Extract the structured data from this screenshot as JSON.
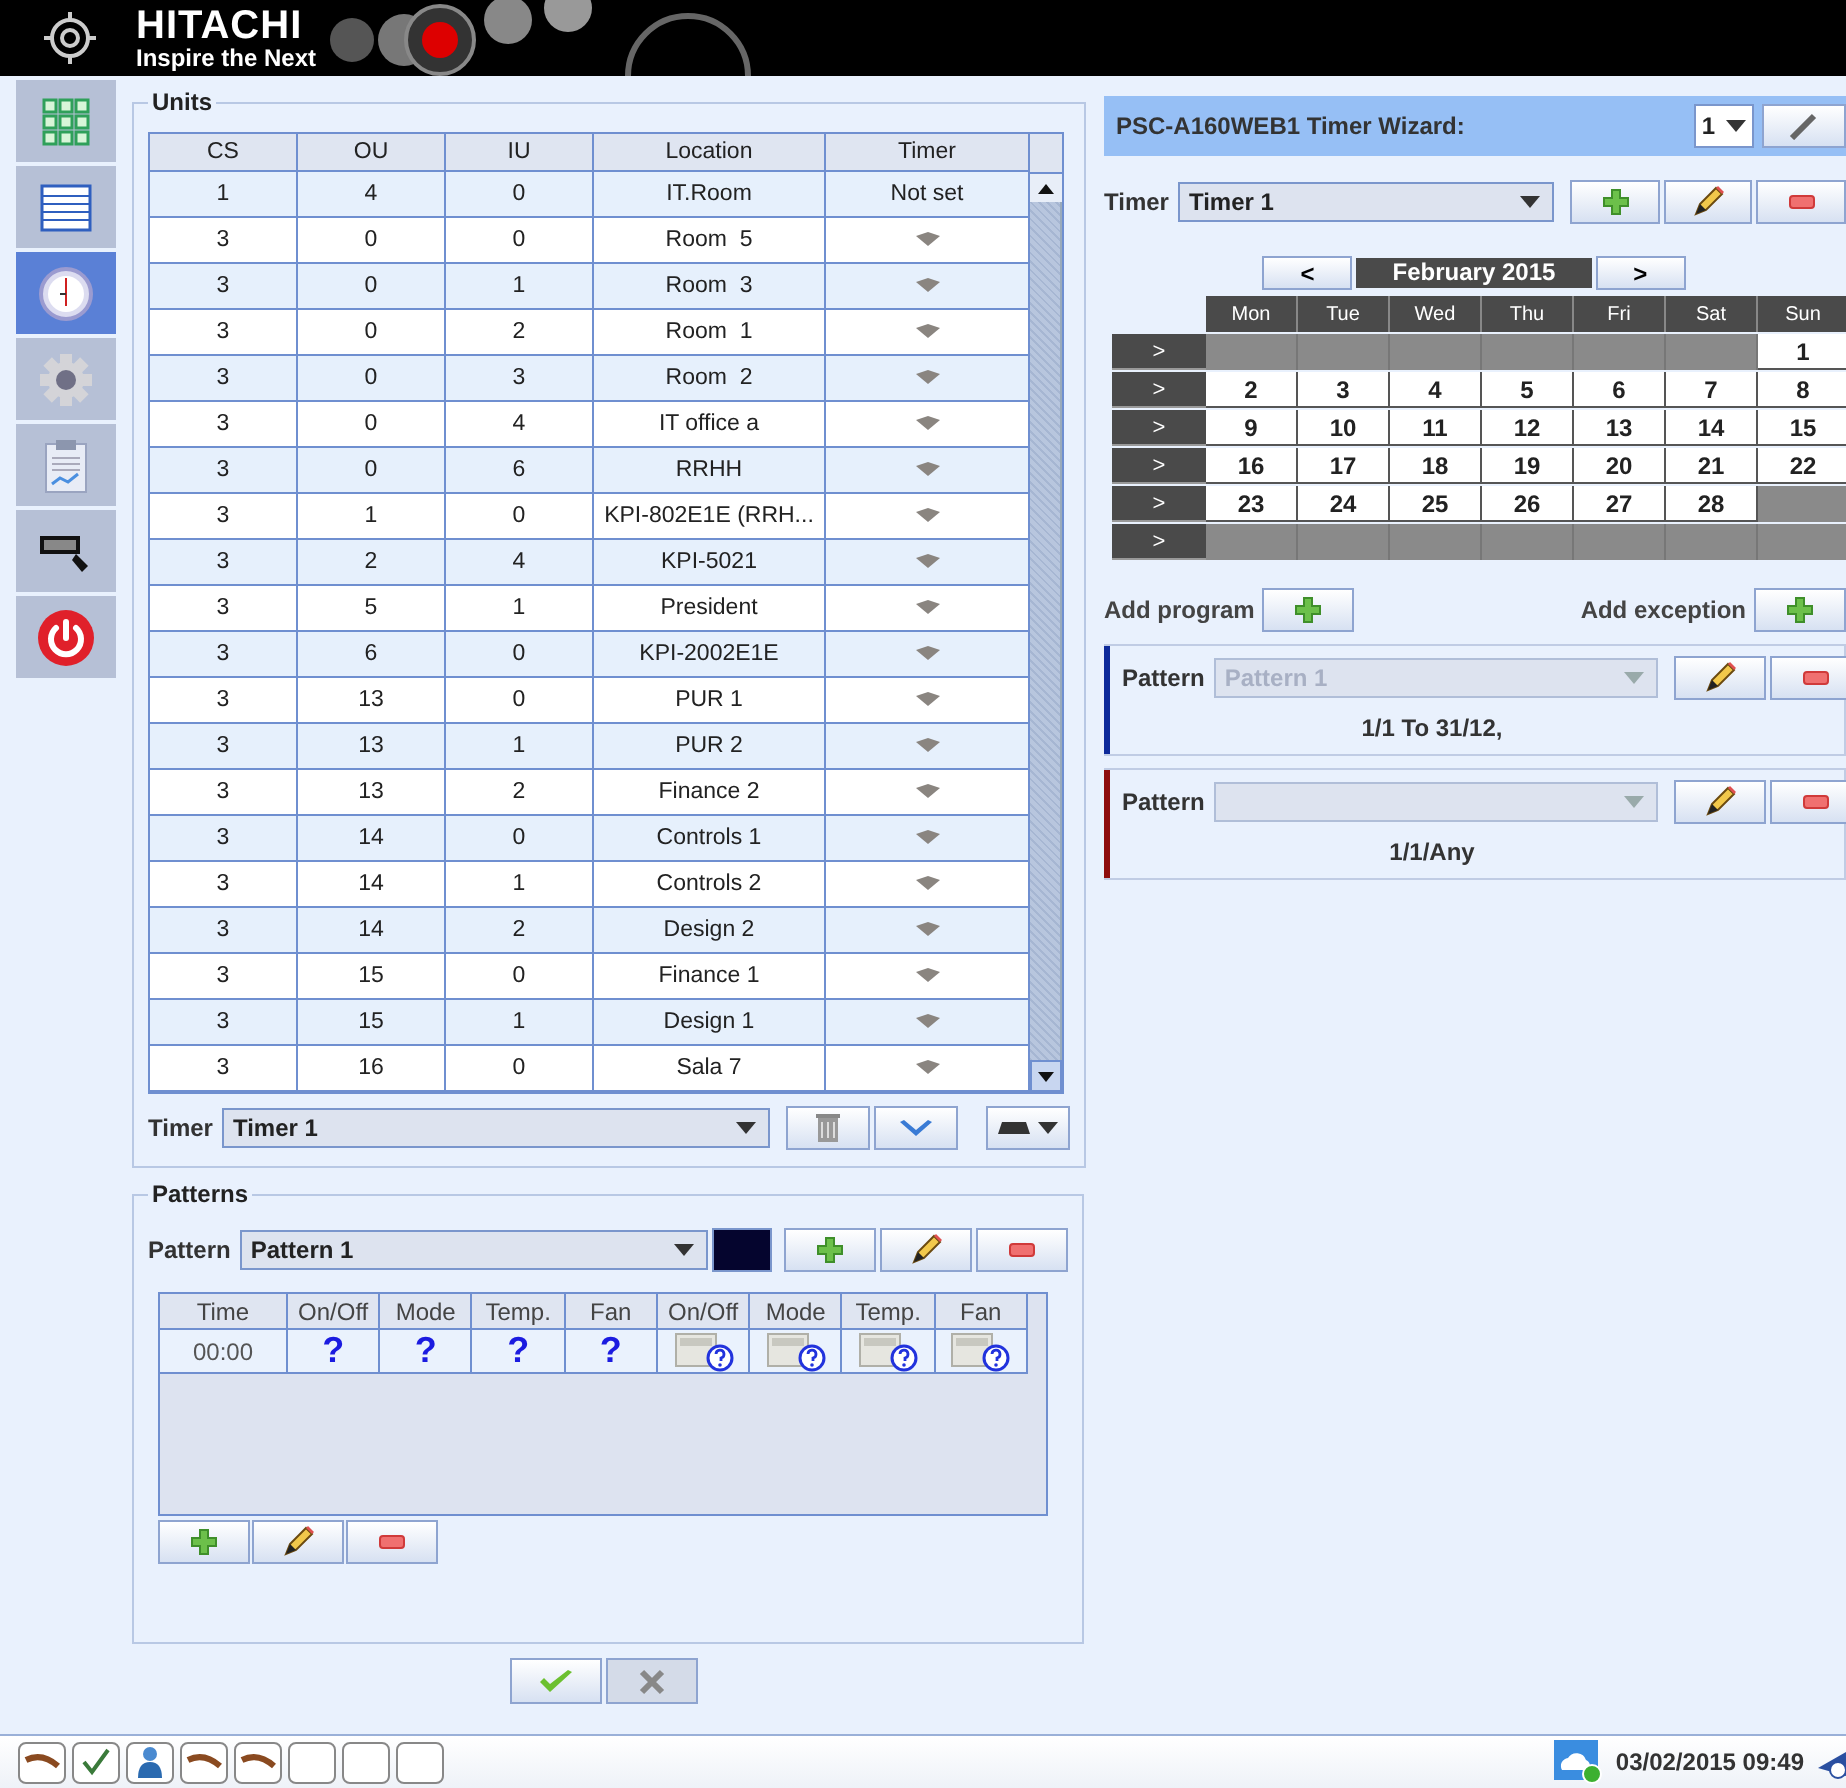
{
  "header": {
    "brand": "HITACHI",
    "slogan": "Inspire the Next"
  },
  "sidebar": {
    "items": [
      {
        "kind": "grid",
        "selected": false
      },
      {
        "kind": "list",
        "selected": false
      },
      {
        "kind": "clock",
        "selected": true
      },
      {
        "kind": "gear",
        "selected": false
      },
      {
        "kind": "report",
        "selected": false
      },
      {
        "kind": "display",
        "selected": false
      },
      {
        "kind": "power",
        "selected": false
      }
    ]
  },
  "units": {
    "title": "Units",
    "columns": [
      "CS",
      "OU",
      "IU",
      "Location",
      "Timer"
    ],
    "rows": [
      {
        "cells": [
          "1",
          "4",
          "0",
          "IT.Room"
        ],
        "timer": {
          "kind": "text",
          "text": "Not set"
        }
      },
      {
        "cells": [
          "3",
          "0",
          "0",
          "Room  5"
        ],
        "timer": {
          "kind": "icon"
        }
      },
      {
        "cells": [
          "3",
          "0",
          "1",
          "Room  3"
        ],
        "timer": {
          "kind": "icon"
        }
      },
      {
        "cells": [
          "3",
          "0",
          "2",
          "Room  1"
        ],
        "timer": {
          "kind": "icon"
        }
      },
      {
        "cells": [
          "3",
          "0",
          "3",
          "Room  2"
        ],
        "timer": {
          "kind": "icon"
        }
      },
      {
        "cells": [
          "3",
          "0",
          "4",
          "IT office a"
        ],
        "timer": {
          "kind": "icon"
        }
      },
      {
        "cells": [
          "3",
          "0",
          "6",
          "RRHH"
        ],
        "timer": {
          "kind": "icon"
        }
      },
      {
        "cells": [
          "3",
          "1",
          "0",
          "KPI-802E1E (RRH..."
        ],
        "timer": {
          "kind": "icon"
        }
      },
      {
        "cells": [
          "3",
          "2",
          "4",
          "KPI-5021"
        ],
        "timer": {
          "kind": "icon"
        }
      },
      {
        "cells": [
          "3",
          "5",
          "1",
          "President"
        ],
        "timer": {
          "kind": "icon"
        }
      },
      {
        "cells": [
          "3",
          "6",
          "0",
          "KPI-2002E1E"
        ],
        "timer": {
          "kind": "icon"
        }
      },
      {
        "cells": [
          "3",
          "13",
          "0",
          "PUR 1"
        ],
        "timer": {
          "kind": "icon"
        }
      },
      {
        "cells": [
          "3",
          "13",
          "1",
          "PUR 2"
        ],
        "timer": {
          "kind": "icon"
        }
      },
      {
        "cells": [
          "3",
          "13",
          "2",
          "Finance 2"
        ],
        "timer": {
          "kind": "icon"
        }
      },
      {
        "cells": [
          "3",
          "14",
          "0",
          "Controls 1"
        ],
        "timer": {
          "kind": "icon"
        }
      },
      {
        "cells": [
          "3",
          "14",
          "1",
          "Controls 2"
        ],
        "timer": {
          "kind": "icon"
        }
      },
      {
        "cells": [
          "3",
          "14",
          "2",
          "Design 2"
        ],
        "timer": {
          "kind": "icon"
        }
      },
      {
        "cells": [
          "3",
          "15",
          "0",
          "Finance 1"
        ],
        "timer": {
          "kind": "icon"
        }
      },
      {
        "cells": [
          "3",
          "15",
          "1",
          "Design 1"
        ],
        "timer": {
          "kind": "icon"
        }
      },
      {
        "cells": [
          "3",
          "16",
          "0",
          "Sala 7"
        ],
        "timer": {
          "kind": "icon"
        }
      }
    ],
    "timer_label": "Timer",
    "timer_value": "Timer 1"
  },
  "patterns": {
    "title": "Patterns",
    "pattern_label": "Pattern",
    "pattern_value": "Pattern 1",
    "color": "#05052e",
    "columns": [
      "Time",
      "On/Off",
      "Mode",
      "Temp.",
      "Fan",
      "On/Off",
      "Mode",
      "Temp.",
      "Fan"
    ],
    "rows": [
      {
        "cells": [
          {
            "kind": "text",
            "text": "00:00"
          },
          {
            "kind": "question",
            "text": "?"
          },
          {
            "kind": "question",
            "text": "?"
          },
          {
            "kind": "question",
            "text": "?"
          },
          {
            "kind": "question",
            "text": "?"
          },
          {
            "kind": "remote"
          },
          {
            "kind": "remote"
          },
          {
            "kind": "remote"
          },
          {
            "kind": "remote"
          }
        ]
      }
    ]
  },
  "wizard": {
    "title": "PSC-A160WEB1 Timer Wizard:",
    "selector": "1",
    "timer_label": "Timer",
    "timer_value": "Timer 1",
    "calendar": {
      "month": "February 2015",
      "prev": "<",
      "next": ">",
      "weekdays": [
        "Mon",
        "Tue",
        "Wed",
        "Thu",
        "Fri",
        "Sat",
        "Sun"
      ],
      "weeks": [
        {
          "button": ">",
          "days": [
            {
              "kind": "blank"
            },
            {
              "kind": "blank"
            },
            {
              "kind": "blank"
            },
            {
              "kind": "blank"
            },
            {
              "kind": "blank"
            },
            {
              "kind": "blank"
            },
            {
              "kind": "day",
              "label": "1"
            }
          ]
        },
        {
          "button": ">",
          "days": [
            {
              "kind": "day",
              "label": "2"
            },
            {
              "kind": "day",
              "label": "3"
            },
            {
              "kind": "day",
              "label": "4"
            },
            {
              "kind": "day",
              "label": "5"
            },
            {
              "kind": "day",
              "label": "6"
            },
            {
              "kind": "day",
              "label": "7"
            },
            {
              "kind": "day",
              "label": "8"
            }
          ]
        },
        {
          "button": ">",
          "days": [
            {
              "kind": "day",
              "label": "9"
            },
            {
              "kind": "day",
              "label": "10"
            },
            {
              "kind": "day",
              "label": "11"
            },
            {
              "kind": "day",
              "label": "12"
            },
            {
              "kind": "day",
              "label": "13"
            },
            {
              "kind": "day",
              "label": "14"
            },
            {
              "kind": "day",
              "label": "15"
            }
          ]
        },
        {
          "button": ">",
          "days": [
            {
              "kind": "day",
              "label": "16"
            },
            {
              "kind": "day",
              "label": "17"
            },
            {
              "kind": "day",
              "label": "18"
            },
            {
              "kind": "day",
              "label": "19"
            },
            {
              "kind": "day",
              "label": "20"
            },
            {
              "kind": "day",
              "label": "21"
            },
            {
              "kind": "day",
              "label": "22"
            }
          ]
        },
        {
          "button": ">",
          "days": [
            {
              "kind": "day",
              "label": "23"
            },
            {
              "kind": "day",
              "label": "24"
            },
            {
              "kind": "day",
              "label": "25"
            },
            {
              "kind": "day",
              "label": "26"
            },
            {
              "kind": "day",
              "label": "27"
            },
            {
              "kind": "day",
              "label": "28"
            },
            {
              "kind": "blank"
            }
          ]
        },
        {
          "button": ">",
          "days": [
            {
              "kind": "blank"
            },
            {
              "kind": "blank"
            },
            {
              "kind": "blank"
            },
            {
              "kind": "blank"
            },
            {
              "kind": "blank"
            },
            {
              "kind": "blank"
            },
            {
              "kind": "blank"
            }
          ]
        }
      ]
    },
    "add_program": "Add program",
    "add_exception": "Add exception",
    "programs": [
      {
        "label": "Pattern",
        "value": "Pattern 1",
        "range": "1/1 To 31/12,",
        "color": "#0d2a9a"
      },
      {
        "label": "Pattern",
        "range": "1/1/Any",
        "color": "#8e0d0d"
      }
    ]
  },
  "status_bar": {
    "slots": [
      {
        "kind": "curve"
      },
      {
        "kind": "check"
      },
      {
        "kind": "person"
      },
      {
        "kind": "curve"
      },
      {
        "kind": "curve"
      },
      {
        "kind": "empty"
      },
      {
        "kind": "empty"
      },
      {
        "kind": "empty"
      }
    ],
    "datetime": "03/02/2015 09:49"
  }
}
